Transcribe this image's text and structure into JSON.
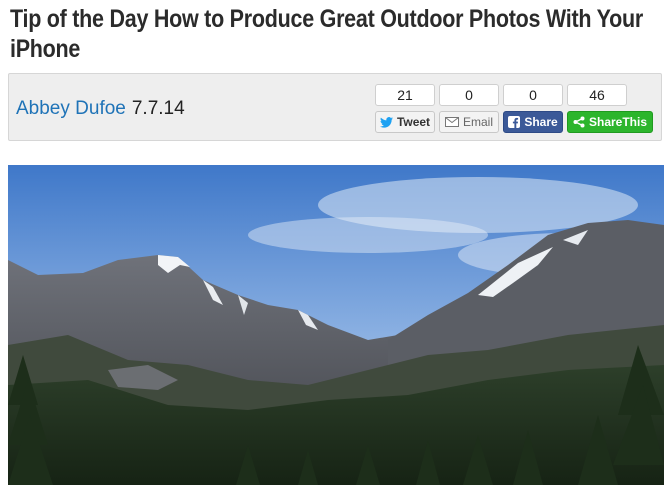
{
  "article": {
    "title": "Tip of the Day How to Produce Great Outdoor Photos With Your iPhone",
    "author": "Abbey Dufoe",
    "date": "7.7.14"
  },
  "share": {
    "tweet": {
      "count": "21",
      "label": "Tweet",
      "icon": "twitter-bird-icon"
    },
    "email": {
      "count": "0",
      "label": "Email",
      "icon": "envelope-icon"
    },
    "facebook": {
      "count": "0",
      "label": "Share",
      "icon": "facebook-icon"
    },
    "sharethis": {
      "count": "46",
      "label": "ShareThis",
      "icon": "share-icon"
    }
  },
  "colors": {
    "author_link": "#1f73b7",
    "facebook": "#3b5998",
    "sharethis": "#2cb52c"
  },
  "image": {
    "subject": "mountain landscape photo"
  }
}
